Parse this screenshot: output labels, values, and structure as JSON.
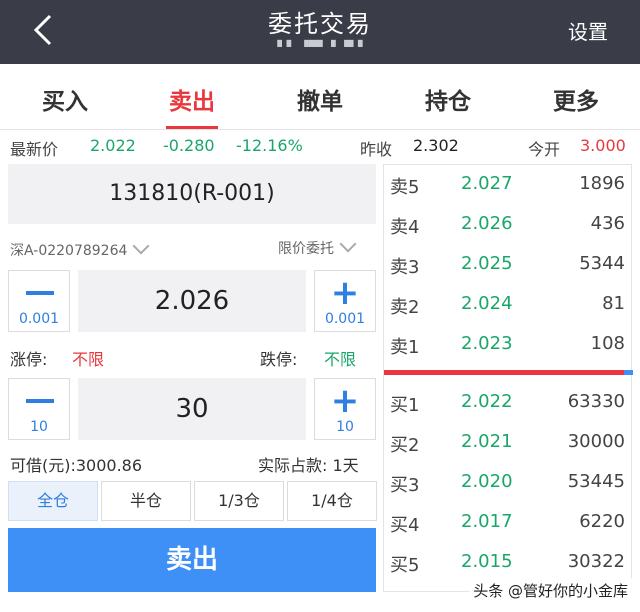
{
  "header": {
    "title": "委托交易",
    "subtitle": "▘▘ ▝▀▘ ▘ ▀▝",
    "settings_label": "设置"
  },
  "tabs": [
    {
      "label": "买入"
    },
    {
      "label": "卖出",
      "active": true
    },
    {
      "label": "撤单"
    },
    {
      "label": "持仓"
    },
    {
      "label": "更多"
    }
  ],
  "quote": {
    "last_label": "最新价",
    "last_price": "2.022",
    "change": "-0.280",
    "change_pct": "-12.16%",
    "prev_close_label": "昨收",
    "prev_close": "2.302",
    "open_label": "今开",
    "open": "3.000"
  },
  "order": {
    "security": "131810(R-001)",
    "account": "深A-0220789264",
    "order_type": "限价委托",
    "price": "2.026",
    "price_step": "0.001",
    "limit_up_label": "涨停:",
    "limit_up_value": "不限",
    "limit_down_label": "跌停:",
    "limit_down_value": "不限",
    "quantity": "30",
    "qty_step": "10",
    "available_label": "可借(元):3000.86",
    "occupied_label": "实际占款: 1天",
    "position_buttons": [
      "全仓",
      "半仓",
      "1/3仓",
      "1/4仓"
    ],
    "submit_label": "卖出"
  },
  "order_book": {
    "asks": [
      {
        "label": "卖5",
        "price": "2.027",
        "volume": "1896"
      },
      {
        "label": "卖4",
        "price": "2.026",
        "volume": "436"
      },
      {
        "label": "卖3",
        "price": "2.025",
        "volume": "5344"
      },
      {
        "label": "卖2",
        "price": "2.024",
        "volume": "81"
      },
      {
        "label": "卖1",
        "price": "2.023",
        "volume": "108"
      }
    ],
    "bids": [
      {
        "label": "买1",
        "price": "2.022",
        "volume": "63330"
      },
      {
        "label": "买2",
        "price": "2.021",
        "volume": "30000"
      },
      {
        "label": "买3",
        "price": "2.020",
        "volume": "53445"
      },
      {
        "label": "买4",
        "price": "2.017",
        "volume": "6220"
      },
      {
        "label": "买5",
        "price": "2.015",
        "volume": "30322"
      }
    ]
  },
  "watermark": "头条 @管好你的小金库",
  "colors": {
    "accent_red": "#e8383d",
    "accent_blue": "#3e8ff6",
    "price_green": "#1aa66b",
    "header_bg": "#3a3d47"
  }
}
